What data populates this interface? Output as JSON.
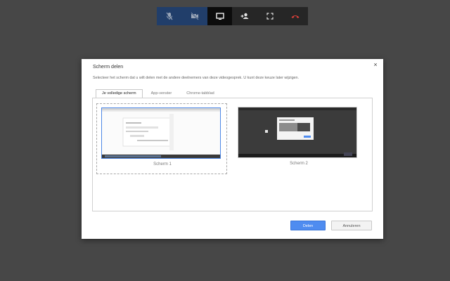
{
  "toolbar": {
    "buttons": [
      {
        "name": "mic-muted-icon",
        "state": "muted"
      },
      {
        "name": "camera-off-icon",
        "state": "muted"
      },
      {
        "name": "screen-share-icon",
        "state": "active"
      },
      {
        "name": "add-person-icon",
        "state": "normal"
      },
      {
        "name": "fullscreen-icon",
        "state": "normal"
      },
      {
        "name": "hang-up-icon",
        "state": "normal"
      }
    ],
    "colors": {
      "muted_bg": "#213e6a",
      "hangup": "#e0403a"
    }
  },
  "dialog": {
    "title": "Scherm delen",
    "close_glyph": "×",
    "description": "Selecteer het scherm dat u wilt delen met de andere deelnemers van deze video­gesprek. U kunt deze keuze later wijzigen.",
    "tabs": [
      {
        "label": "Je volledige scherm",
        "active": true
      },
      {
        "label": "App-venster",
        "active": false
      },
      {
        "label": "Chrome-tabblad",
        "active": false
      }
    ],
    "screens": [
      {
        "label": "Scherm 1",
        "selected": true
      },
      {
        "label": "Scherm 2",
        "selected": false
      }
    ],
    "share_label": "Delen",
    "cancel_label": "Annuleren"
  }
}
